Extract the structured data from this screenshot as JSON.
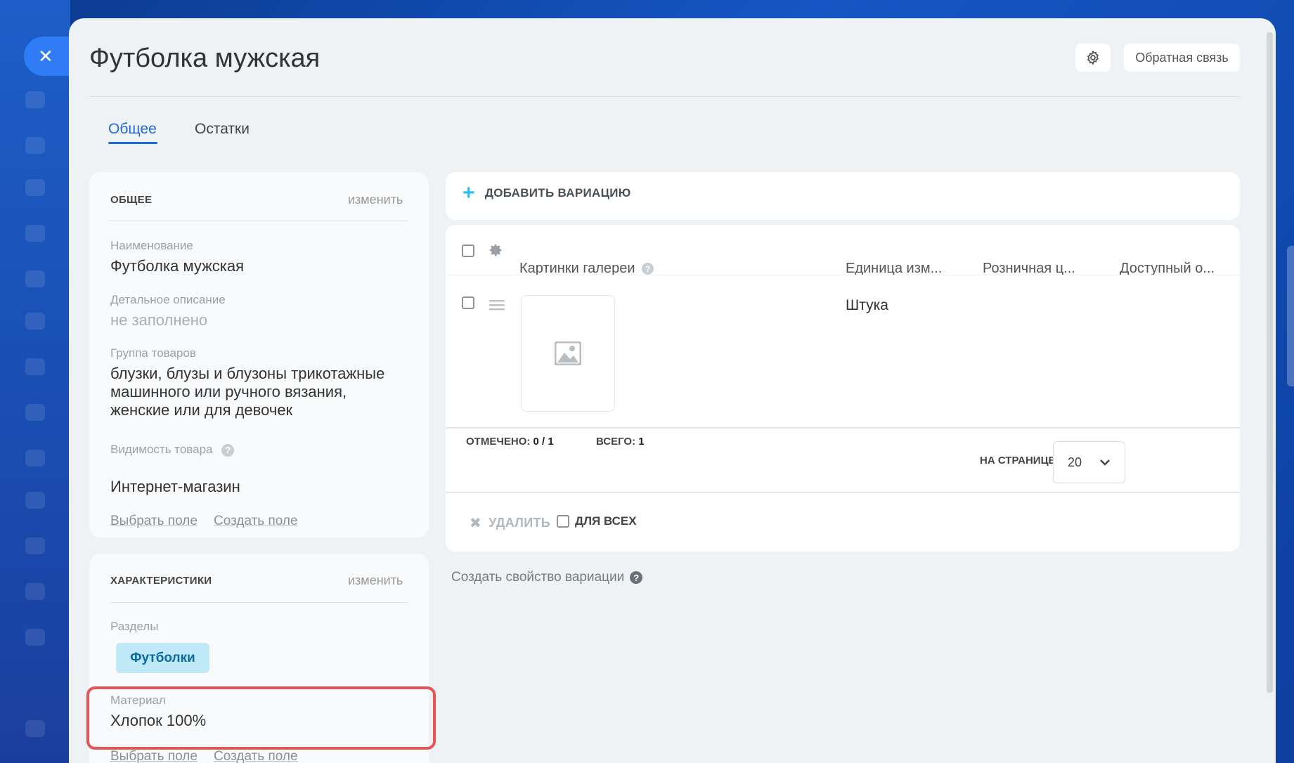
{
  "page": {
    "title": "Футболка мужская",
    "feedback_label": "Обратная связь"
  },
  "tabs": [
    {
      "label": "Общее",
      "active": true
    },
    {
      "label": "Остатки",
      "active": false
    }
  ],
  "general_section": {
    "heading": "ОБЩЕЕ",
    "change_label": "изменить",
    "fields": [
      {
        "label": "Наименование",
        "value": "Футболка мужская"
      },
      {
        "label": "Детальное описание",
        "value": "не заполнено"
      },
      {
        "label": "Группа товаров",
        "value": "блузки, блузы и блузоны трикотажные машинного или ручного вязания, женские или для девочек"
      },
      {
        "label": "Видимость товара",
        "value": "Интернет-магазин"
      }
    ],
    "select_field_label": "Выбрать поле",
    "create_field_label": "Создать поле"
  },
  "characteristics_section": {
    "heading": "ХАРАКТЕРИСТИКИ",
    "change_label": "изменить",
    "sections_label": "Разделы",
    "section_tag": "Футболки",
    "material_label": "Материал",
    "material_value": "Хлопок 100%",
    "select_field_label": "Выбрать поле",
    "create_field_label": "Создать поле"
  },
  "variations": {
    "add_label": "ДОБАВИТЬ ВАРИАЦИЮ",
    "columns": [
      "Картинки галереи",
      "Единица изм...",
      "Розничная ц...",
      "Доступный о..."
    ],
    "rows": [
      {
        "unit": "Штука",
        "price": "",
        "available": ""
      }
    ],
    "footer": {
      "marked_label": "ОТМЕЧЕНО:",
      "marked_value": "0 / 1",
      "total_label": "ВСЕГО:",
      "total_value": "1",
      "per_page_label": "НА СТРАНИЦЕ:",
      "per_page_value": "20"
    },
    "delete_label": "УДАЛИТЬ",
    "for_all_label": "ДЛЯ ВСЕХ",
    "create_property_label": "Создать свойство вариации"
  },
  "colors": {
    "accent": "#1f6ad6",
    "highlight": "#e55555",
    "tag_bg": "#bfe9f7"
  }
}
